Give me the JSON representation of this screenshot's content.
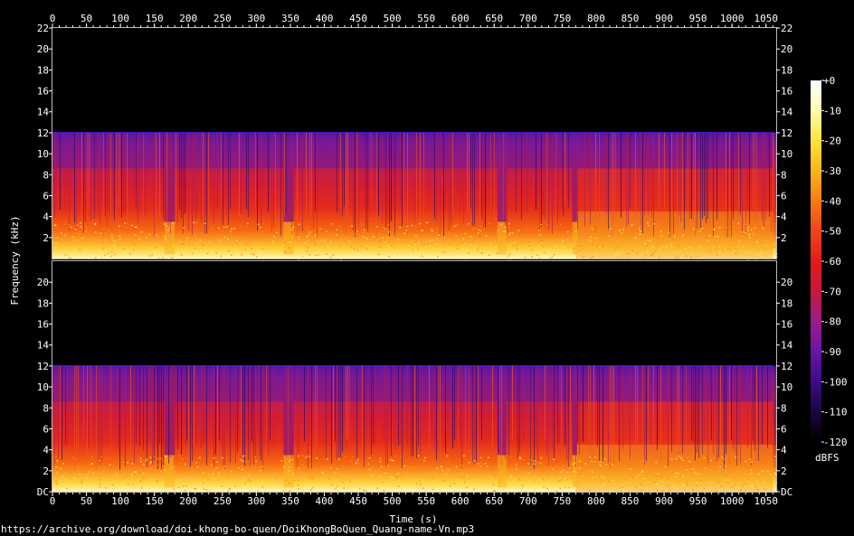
{
  "chart_data": {
    "type": "heatmap",
    "kind": "spectrogram",
    "channels": 2,
    "xlabel": "Time (s)",
    "ylabel": "Frequency (kHz)",
    "xlim": [
      0,
      1065
    ],
    "ylim": [
      0,
      22
    ],
    "x_ticks": [
      0,
      50,
      100,
      150,
      200,
      250,
      300,
      350,
      400,
      450,
      500,
      550,
      600,
      650,
      700,
      750,
      800,
      850,
      900,
      950,
      1000,
      1050
    ],
    "y_ticks_upper": [
      "2",
      "4",
      "6",
      "8",
      "10",
      "12",
      "14",
      "16",
      "18",
      "20",
      "22"
    ],
    "y_ticks_lower": [
      "DC",
      "2",
      "4",
      "6",
      "8",
      "10",
      "12",
      "14",
      "16",
      "18",
      "20"
    ],
    "colorbar": {
      "label": "dBFS",
      "range": [
        -120,
        0
      ],
      "ticks": [
        "+0",
        "-10",
        "-20",
        "-30",
        "-40",
        "-50",
        "-60",
        "-70",
        "-80",
        "-90",
        "-100",
        "-110",
        "-120"
      ],
      "colors": [
        "#000000",
        "#1a0640",
        "#3b0b82",
        "#6a14a6",
        "#9a1c8a",
        "#c8183f",
        "#e41a1c",
        "#f0441a",
        "#f97a14",
        "#fbb41a",
        "#fde33a",
        "#fffbb0",
        "#ffffff"
      ]
    },
    "series": [
      {
        "values": [
          {
            "t": [
              0,
              770
            ],
            "cutoff_khz": 12.0,
            "band_khz": 8.6
          },
          {
            "t": [
              770,
              1060
            ],
            "cutoff_khz": 12.0,
            "band_khz": 8.6,
            "louder": true
          }
        ]
      }
    ],
    "quiet_sections_s": [
      [
        165,
        180
      ],
      [
        340,
        355
      ],
      [
        655,
        668
      ],
      [
        765,
        772
      ]
    ]
  },
  "footer": {
    "source": "https://archive.org/download/doi-khong-bo-quen/DoiKhongBoQuen_Quang-name-Vn.mp3"
  }
}
